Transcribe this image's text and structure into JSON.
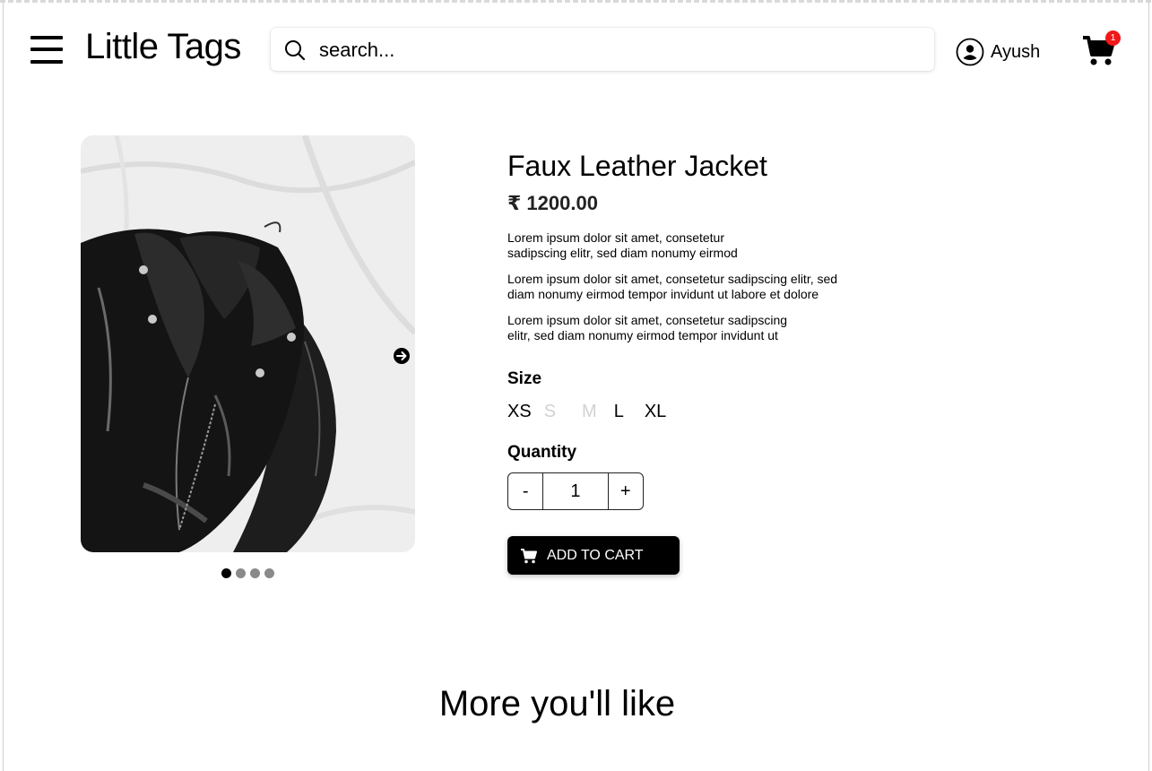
{
  "header": {
    "brand": "Little Tags",
    "search_placeholder": "search...",
    "user_name": "Ayush",
    "cart_count": "1"
  },
  "gallery": {
    "image_alt": "Black faux leather jacket on white sheet",
    "active_index": 0,
    "slide_count": 4
  },
  "product": {
    "title": "Faux Leather Jacket",
    "price": "₹ 1200.00",
    "descriptions": [
      "Lorem ipsum dolor sit amet, consetetur sadipscing elitr, sed diam nonumy eirmod",
      "Lorem ipsum dolor sit amet, consetetur sadipscing elitr, sed diam nonumy eirmod tempor invidunt ut labore et dolore",
      "Lorem ipsum dolor sit amet, consetetur sadipscing elitr, sed diam nonumy eirmod tempor invidunt ut"
    ],
    "size_label": "Size",
    "sizes": [
      {
        "label": "XS",
        "available": true
      },
      {
        "label": "S",
        "available": false
      },
      {
        "label": "M",
        "available": false
      },
      {
        "label": "L",
        "available": true
      },
      {
        "label": "XL",
        "available": true
      }
    ],
    "quantity_label": "Quantity",
    "quantity": {
      "minus": "-",
      "value": "1",
      "plus": "+"
    },
    "add_to_cart": "ADD TO CART"
  },
  "recommendations": {
    "heading": "More you'll like"
  },
  "colors": {
    "badge": "#f01818",
    "button_bg": "#000000",
    "disabled_size": "#d2d2d2"
  }
}
